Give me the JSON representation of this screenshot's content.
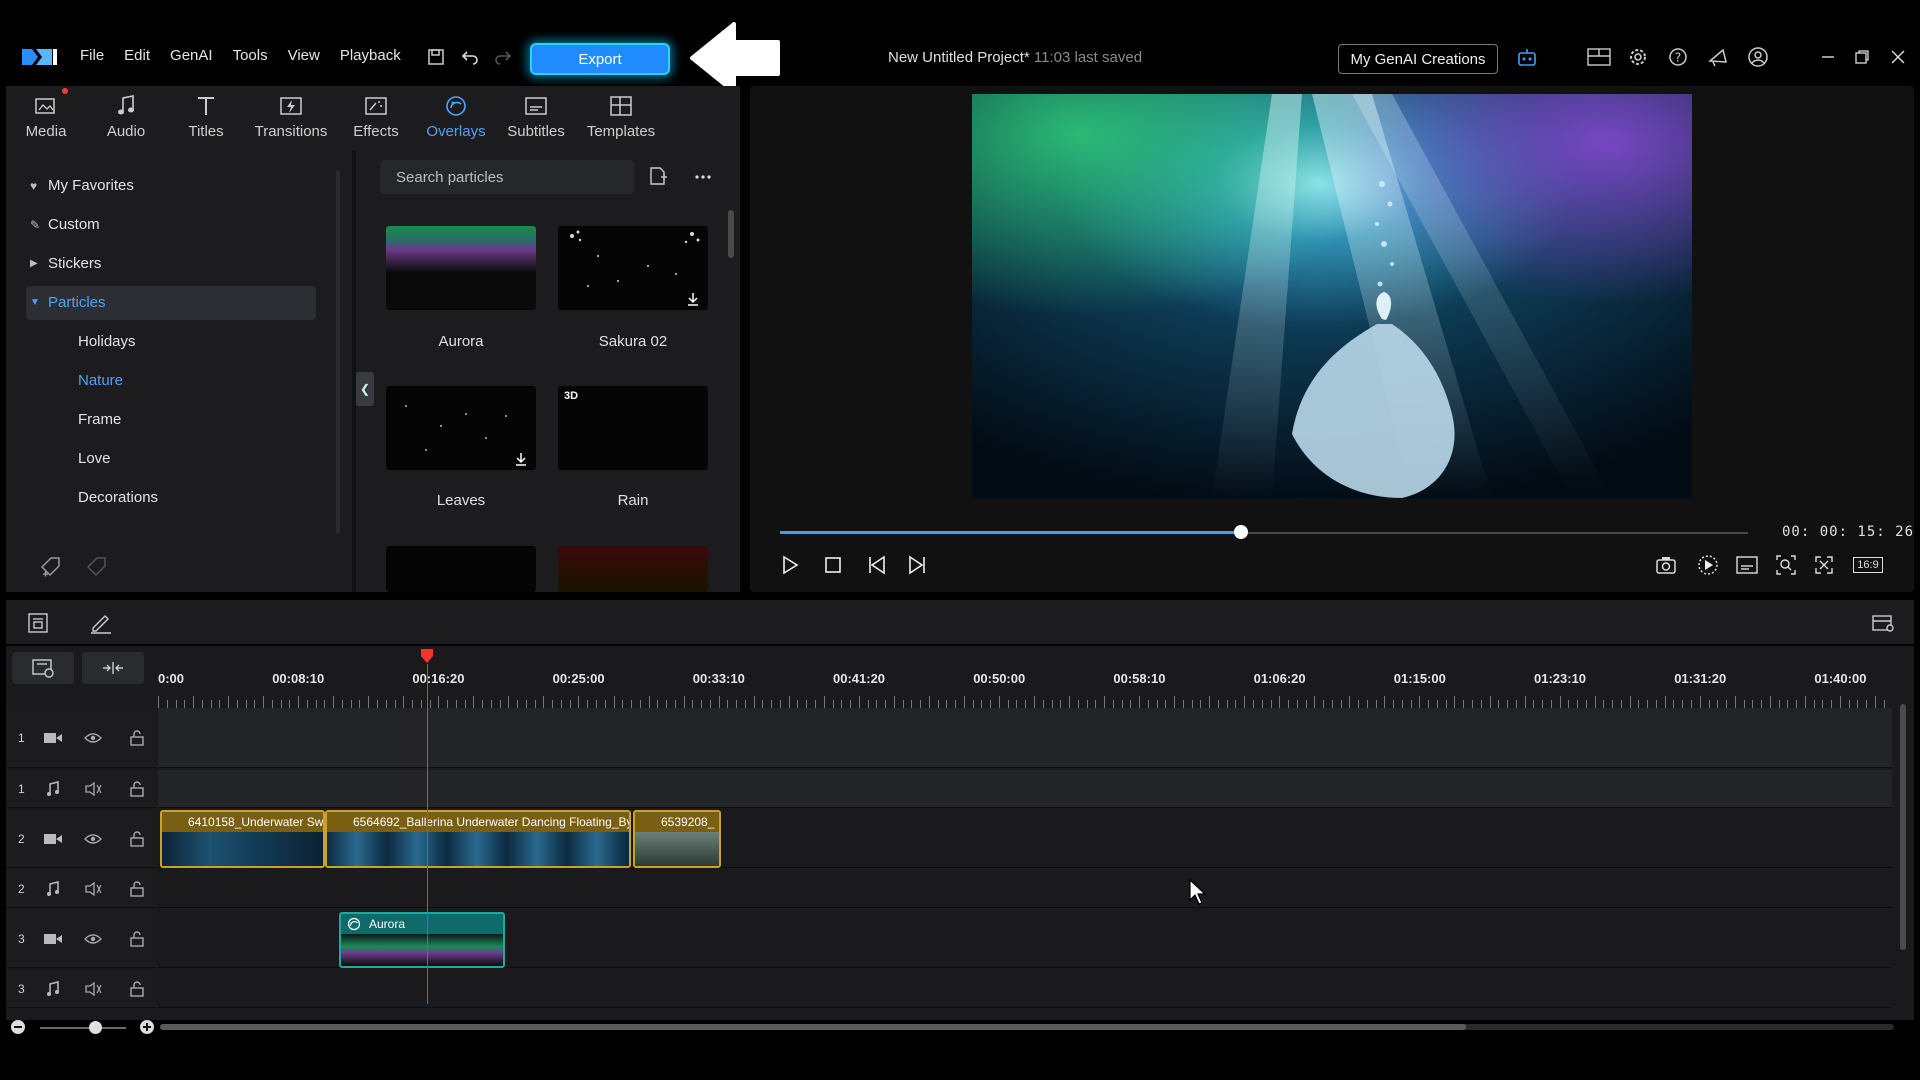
{
  "menu": [
    "File",
    "Edit",
    "GenAI",
    "Tools",
    "View",
    "Playback"
  ],
  "export_label": "Export",
  "project": {
    "title": "New Untitled Project*",
    "saved": "11:03 last saved"
  },
  "genai_button": "My GenAI Creations",
  "tabs": [
    {
      "label": "Media",
      "icon": "media-icon"
    },
    {
      "label": "Audio",
      "icon": "music-note-icon"
    },
    {
      "label": "Titles",
      "icon": "title-t-icon"
    },
    {
      "label": "Transitions",
      "icon": "transitions-icon"
    },
    {
      "label": "Effects",
      "icon": "effects-icon"
    },
    {
      "label": "Overlays",
      "icon": "overlays-icon"
    },
    {
      "label": "Subtitles",
      "icon": "subtitles-icon"
    },
    {
      "label": "Templates",
      "icon": "templates-icon"
    }
  ],
  "active_tab": "Overlays",
  "tree": {
    "top": [
      "My Favorites",
      "Custom",
      "Stickers",
      "Particles"
    ],
    "sub": [
      "Holidays",
      "Nature",
      "Frame",
      "Love",
      "Decorations"
    ],
    "selected": "Particles",
    "highlighted_sub": "Nature"
  },
  "search": {
    "placeholder": "Search particles"
  },
  "thumbnails": [
    {
      "label": "Aurora",
      "badge": ""
    },
    {
      "label": "Sakura 02",
      "badge": ""
    },
    {
      "label": "Leaves",
      "badge": ""
    },
    {
      "label": "Rain",
      "badge": "3D"
    }
  ],
  "preview": {
    "timecode": "00: 00: 15: 26",
    "progress": 0.476,
    "aspect": "16:9"
  },
  "ruler": [
    "0:00",
    "00:08:10",
    "00:16:20",
    "00:25:00",
    "00:33:10",
    "00:41:20",
    "00:50:00",
    "00:58:10",
    "01:06:20",
    "01:15:00",
    "01:23:10",
    "01:31:20",
    "01:40:00"
  ],
  "tracks": [
    {
      "num": "1",
      "type": "video"
    },
    {
      "num": "1",
      "type": "audio"
    },
    {
      "num": "2",
      "type": "video"
    },
    {
      "num": "2",
      "type": "audio"
    },
    {
      "num": "3",
      "type": "video"
    },
    {
      "num": "3",
      "type": "audio"
    }
  ],
  "clips": {
    "c1": "6410158_Underwater Sw",
    "c2": "6564692_Ballerina Underwater Dancing Floating_By",
    "c3": "6539208_",
    "overlay": "Aurora"
  },
  "colors": {
    "accent": "#4aa3ff",
    "export": "#1f8bff",
    "playhead": "#ff3030",
    "clip_border": "#c9a227"
  }
}
